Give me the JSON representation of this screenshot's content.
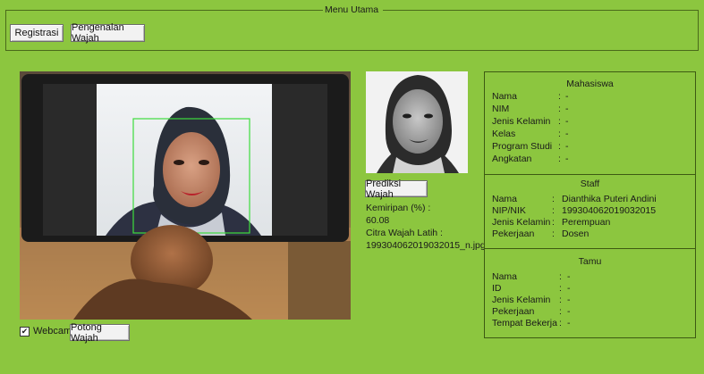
{
  "menu": {
    "title": "Menu Utama",
    "registrasi_label": "Registrasi",
    "pengenalan_label": "Pengenalan Wajah"
  },
  "controls": {
    "webcam_label": "Webcam",
    "webcam_checked": true,
    "potong_label": "Potong Wajah",
    "prediksi_label": "Prediksi Wajah"
  },
  "result": {
    "kemiripan_label": "Kemiripan (%) :",
    "kemiripan_value": "60.08",
    "citra_label": "Citra Wajah Latih :",
    "citra_value": "199304062019032015_n.jpg"
  },
  "mahasiswa": {
    "title": "Mahasiswa",
    "fields": [
      {
        "label": "Nama",
        "value": "-"
      },
      {
        "label": "NIM",
        "value": "-"
      },
      {
        "label": "Jenis Kelamin",
        "value": "-"
      },
      {
        "label": "Kelas",
        "value": "-"
      },
      {
        "label": "Program Studi",
        "value": "-"
      },
      {
        "label": "Angkatan",
        "value": "-"
      }
    ]
  },
  "staff": {
    "title": "Staff",
    "fields": [
      {
        "label": "Nama",
        "value": "Dianthika Puteri Andini"
      },
      {
        "label": "NIP/NIK",
        "value": "199304062019032015"
      },
      {
        "label": "Jenis Kelamin",
        "value": "Perempuan"
      },
      {
        "label": "Pekerjaan",
        "value": "Dosen"
      }
    ]
  },
  "tamu": {
    "title": "Tamu",
    "fields": [
      {
        "label": "Nama",
        "value": "-"
      },
      {
        "label": "ID",
        "value": "-"
      },
      {
        "label": "Jenis Kelamin",
        "value": "-"
      },
      {
        "label": "Pekerjaan",
        "value": "-"
      },
      {
        "label": "Tempat Bekerja",
        "value": "-"
      }
    ]
  },
  "colors": {
    "background": "#8cc63f",
    "detection_box": "#3ddc3d"
  }
}
